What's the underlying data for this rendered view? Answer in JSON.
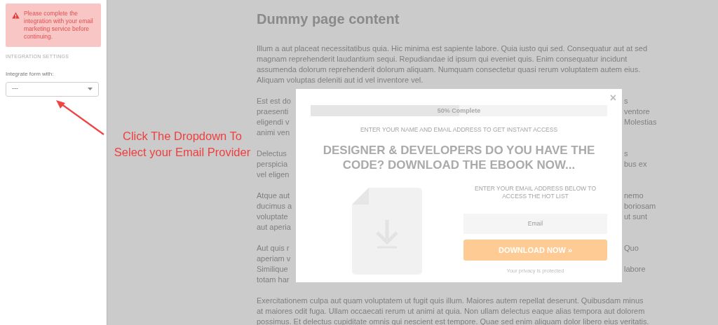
{
  "sidebar": {
    "alert": {
      "text": "Please complete the integration with your email marketing service before continuing."
    },
    "section_title": "INTEGRATION SETTINGS",
    "field_label": "Integrate form with:",
    "dropdown": {
      "value": "---"
    }
  },
  "annotation": {
    "text": "Click The Dropdown To Select your Email Provider"
  },
  "page": {
    "heading": "Dummy page content",
    "paragraphs": [
      {
        "kind": "full",
        "text": "Illum a aut placeat necessitatibus quia. Hic minima est sapiente labore. Quia iusto qui sed. Consequatur aut at sed magnam reprehenderit laudantium sequi. Repudiandae id ipsum qui eveniet quis. Enim consequatur incidunt assumenda dolorum reprehenderit dolorum aliquam. Numquam consectetur quasi rerum voluptatem autem eius. Aliquam voluptas deleniti aut id vel inventore vel."
      },
      {
        "kind": "covered",
        "lines": [
          {
            "left": "Est est do",
            "right": "s"
          },
          {
            "left": "praesenti",
            "right": "ventore"
          },
          {
            "left": "eligendi v",
            "right": "Molestias"
          },
          {
            "left": "animi ven"
          }
        ]
      },
      {
        "kind": "covered",
        "lines": [
          {
            "left": "Delectus",
            "right": "s"
          },
          {
            "left": "perspicia",
            "right": "bus ex"
          },
          {
            "left": "vel eligen"
          }
        ]
      },
      {
        "kind": "covered",
        "lines": [
          {
            "left": "Atque aut",
            "right": "nemo"
          },
          {
            "left": "ducimus a",
            "right": "boriosam"
          },
          {
            "left": "voluptate",
            "right": "ut sunt"
          },
          {
            "left": "aut aperia"
          }
        ]
      },
      {
        "kind": "covered",
        "lines": [
          {
            "left": "Aut quis r",
            "right": "Quo"
          },
          {
            "left": "aperiam v"
          },
          {
            "left": "Similique",
            "right": "labore"
          },
          {
            "left": "totam har"
          }
        ]
      },
      {
        "kind": "full",
        "text": "Exercitationem culpa aut quam voluptatem ut fugit quis illum. Maiores autem repellat deserunt. Quibusdam minus at maiores odit fuga. Ullam occaecati rerum ut animi at quia. Non ullam delectus eaque alias tempora aut dolorem possimus. Et delectus cupiditate omnis qui nescient est tempore. Quae sed enim aliquam dolor libero eius veritatis."
      }
    ]
  },
  "modal": {
    "close": "×",
    "progress": {
      "label": "50% Complete",
      "level": 0.5
    },
    "subtitle": "ENTER YOUR NAME AND EMAIL ADDRESS TO GET INSTANT ACCESS",
    "headline": "DESIGNER & DEVELOPERS DO YOU HAVE THE CODE? DOWNLOAD THE EBOOK NOW...",
    "prompt": "ENTER YOUR EMAIL ADDRESS BELOW TO ACCESS THE HOT LIST",
    "email": {
      "placeholder": "Email"
    },
    "button": "DOWNLOAD NOW »",
    "privacy": "Your privacy is protected"
  }
}
